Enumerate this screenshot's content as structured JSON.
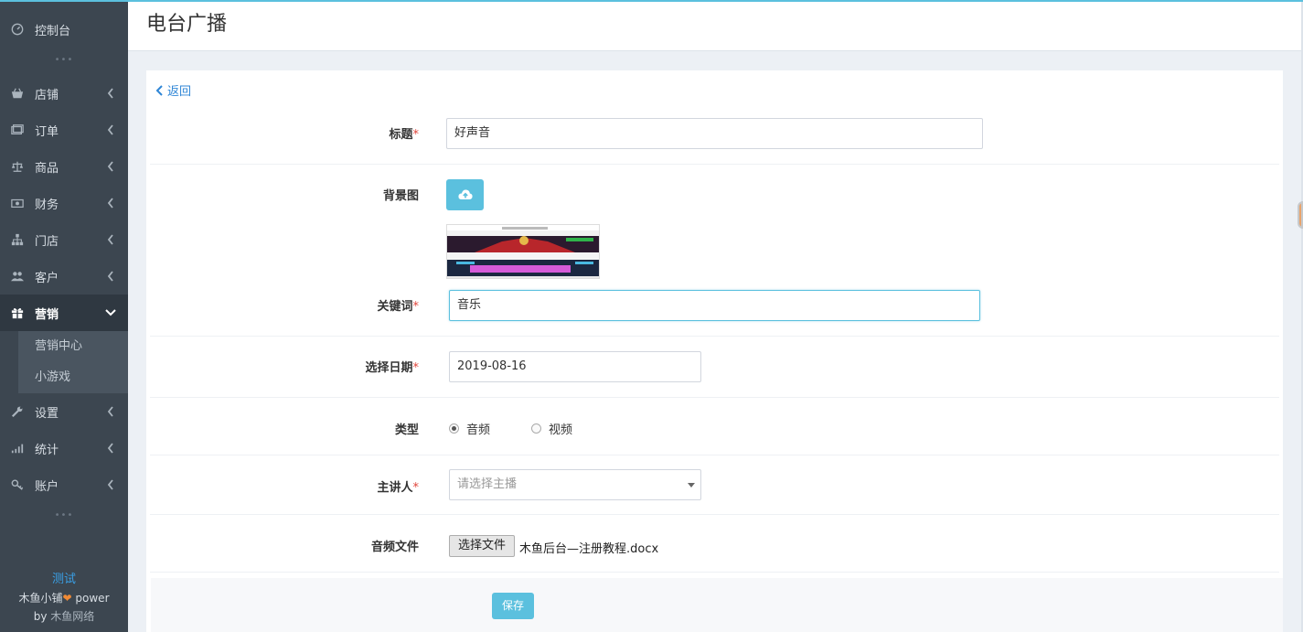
{
  "sidebar": {
    "items": [
      {
        "label": "控制台",
        "icon": "dashboard-icon"
      },
      {
        "label": "店铺",
        "icon": "store-icon"
      },
      {
        "label": "订单",
        "icon": "order-icon"
      },
      {
        "label": "商品",
        "icon": "scale-icon"
      },
      {
        "label": "财务",
        "icon": "money-icon"
      },
      {
        "label": "门店",
        "icon": "sitemap-icon"
      },
      {
        "label": "客户",
        "icon": "users-icon"
      },
      {
        "label": "营销",
        "icon": "gift-icon"
      },
      {
        "label": "设置",
        "icon": "wrench-icon"
      },
      {
        "label": "统计",
        "icon": "signal-icon"
      },
      {
        "label": "账户",
        "icon": "key-icon"
      }
    ],
    "submenu": [
      {
        "label": "营销中心"
      },
      {
        "label": "小游戏"
      }
    ],
    "footer": {
      "test_link": "测试",
      "brand": "木鱼小铺",
      "power": "power",
      "by": "by",
      "company": "木鱼网络"
    }
  },
  "header": {
    "title": "电台广播"
  },
  "form": {
    "back_label": "返回",
    "title": {
      "label": "标题",
      "value": "好声音"
    },
    "background": {
      "label": "背景图"
    },
    "keywords": {
      "label": "关键词",
      "value": "音乐"
    },
    "date": {
      "label": "选择日期",
      "value": "2019-08-16"
    },
    "type": {
      "label": "类型",
      "options": [
        "音频",
        "视频"
      ],
      "selected": "音频"
    },
    "speaker": {
      "label": "主讲人",
      "placeholder": "请选择主播"
    },
    "audio_file": {
      "label": "音频文件",
      "button": "选择文件",
      "filename": "木鱼后台—注册教程.docx"
    },
    "required_mark": "*",
    "save_label": "保存"
  },
  "colors": {
    "accent": "#5bc0de",
    "sidebar_bg": "#3c4650",
    "link": "#2f86d6",
    "required": "#e0443a"
  }
}
